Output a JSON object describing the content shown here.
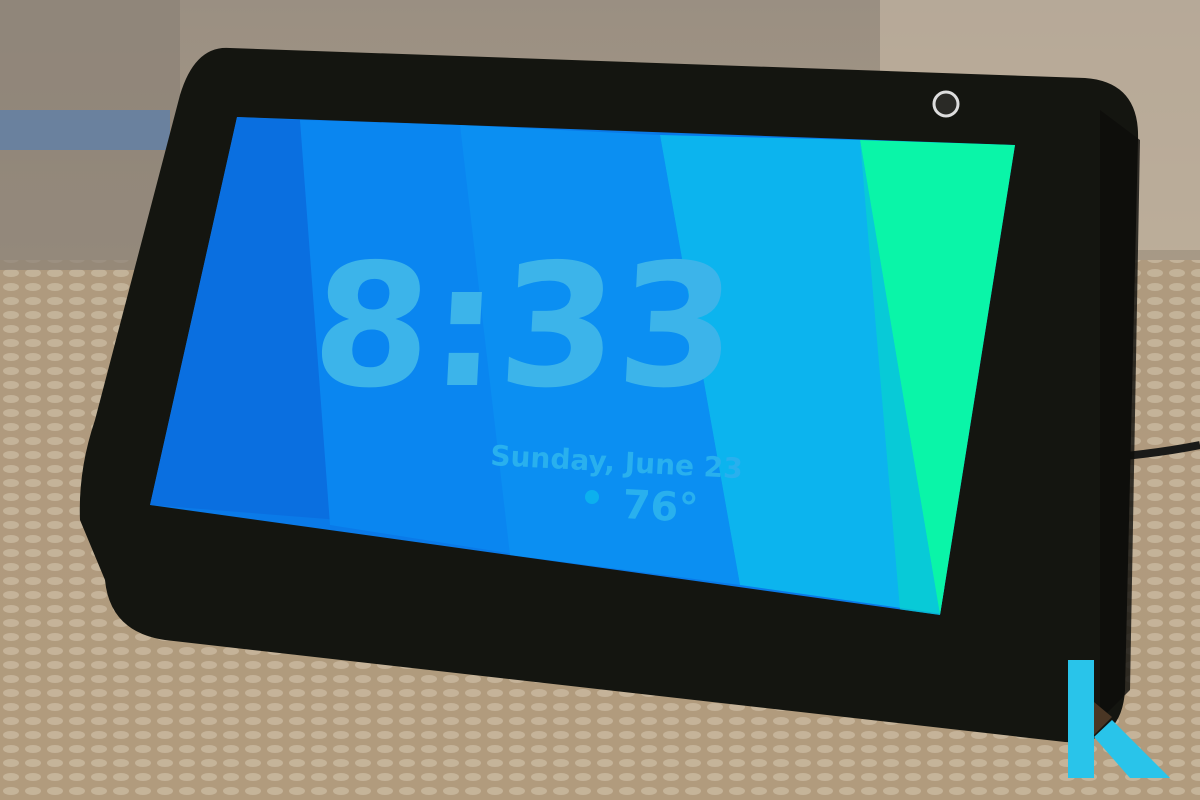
{
  "screen": {
    "time": "8:33",
    "date": "Sunday, June 23",
    "temperature": "76°",
    "weather_icon": "moon-icon"
  },
  "watermark": {
    "letter": "K"
  },
  "colors": {
    "device_body": "#141510",
    "screen_blue_dark": "#0a6fe0",
    "screen_blue": "#0a86f0",
    "screen_cyan": "#0cb4ee",
    "screen_green": "#0af5a8",
    "watermark_cyan": "#29c4ea"
  }
}
